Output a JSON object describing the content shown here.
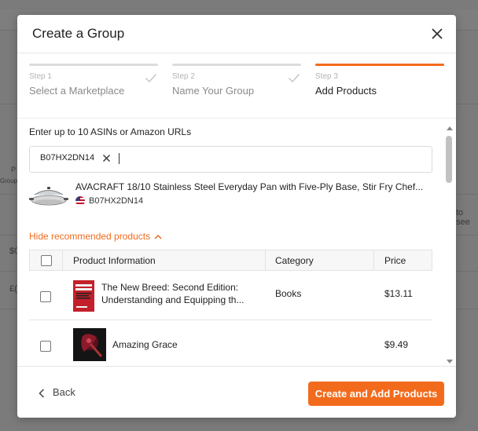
{
  "background": {
    "fragments": [
      "P",
      "Group",
      "$0",
      "£(",
      "to see"
    ]
  },
  "modal": {
    "title": "Create a Group",
    "steps": [
      {
        "number": "Step 1",
        "name": "Select a Marketplace",
        "state": "done"
      },
      {
        "number": "Step 2",
        "name": "Name Your Group",
        "state": "done"
      },
      {
        "number": "Step 3",
        "name": "Add Products",
        "state": "active"
      }
    ],
    "prompt": "Enter up to 10 ASINs or Amazon URLs",
    "asin_chip": "B07HX2DN14",
    "selected_product": {
      "title": "AVACRAFT 18/10 Stainless Steel Everyday Pan with Five-Ply Base, Stir Fry Chef...",
      "asin": "B07HX2DN14"
    },
    "recommend_toggle": "Hide recommended products",
    "table": {
      "headers": [
        "Product Information",
        "Category",
        "Price"
      ],
      "rows": [
        {
          "title_line1": "The New Breed: Second Edition:",
          "title_line2": "Understanding and Equipping th...",
          "category": "Books",
          "price": "$13.11"
        },
        {
          "title_line1": "Amazing Grace",
          "title_line2": "",
          "category": "",
          "price": "$9.49"
        }
      ]
    },
    "footer": {
      "back_label": "Back",
      "primary_label": "Create and Add Products"
    }
  },
  "colors": {
    "accent": "#f26b1d"
  }
}
